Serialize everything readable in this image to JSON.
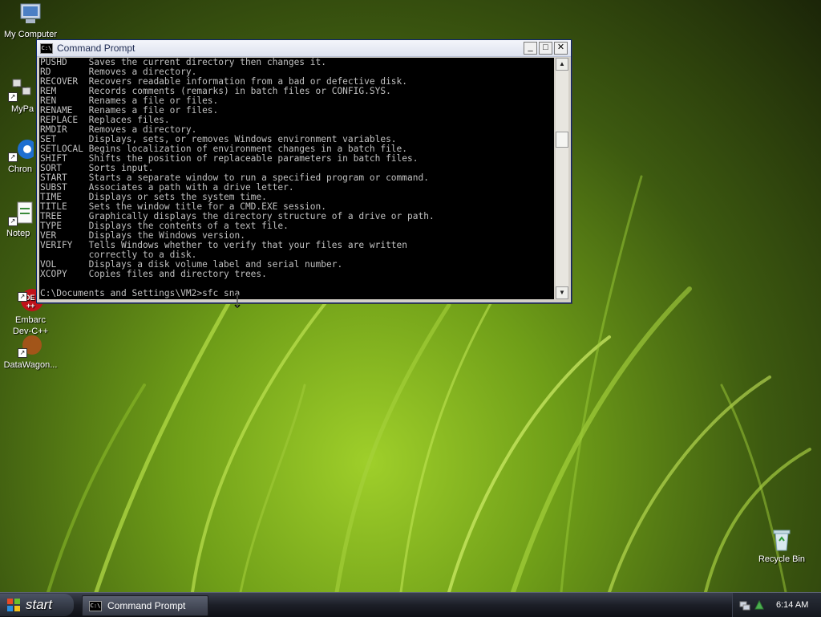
{
  "desktop": {
    "icons": [
      {
        "label": "My Computer"
      },
      {
        "label": "MyPa"
      },
      {
        "label": "Chron"
      },
      {
        "label": "Notep"
      },
      {
        "label": "Embarc\nDev-C++"
      },
      {
        "label": "DataWagon..."
      },
      {
        "label": "Recycle Bin"
      }
    ]
  },
  "window": {
    "title": "Command Prompt",
    "minimize": "_",
    "maximize": "□",
    "close": "✕",
    "lines": [
      "PUSHD    Saves the current directory then changes it.",
      "RD       Removes a directory.",
      "RECOVER  Recovers readable information from a bad or defective disk.",
      "REM      Records comments (remarks) in batch files or CONFIG.SYS.",
      "REN      Renames a file or files.",
      "RENAME   Renames a file or files.",
      "REPLACE  Replaces files.",
      "RMDIR    Removes a directory.",
      "SET      Displays, sets, or removes Windows environment variables.",
      "SETLOCAL Begins localization of environment changes in a batch file.",
      "SHIFT    Shifts the position of replaceable parameters in batch files.",
      "SORT     Sorts input.",
      "START    Starts a separate window to run a specified program or command.",
      "SUBST    Associates a path with a drive letter.",
      "TIME     Displays or sets the system time.",
      "TITLE    Sets the window title for a CMD.EXE session.",
      "TREE     Graphically displays the directory structure of a drive or path.",
      "TYPE     Displays the contents of a text file.",
      "VER      Displays the Windows version.",
      "VERIFY   Tells Windows whether to verify that your files are written",
      "         correctly to a disk.",
      "VOL      Displays a disk volume label and serial number.",
      "XCOPY    Copies files and directory trees."
    ],
    "prompt": "C:\\Documents and Settings\\VM2>sfc sna"
  },
  "taskbar": {
    "start_label": "start",
    "task_label": "Command Prompt",
    "clock": "6:14 AM"
  }
}
